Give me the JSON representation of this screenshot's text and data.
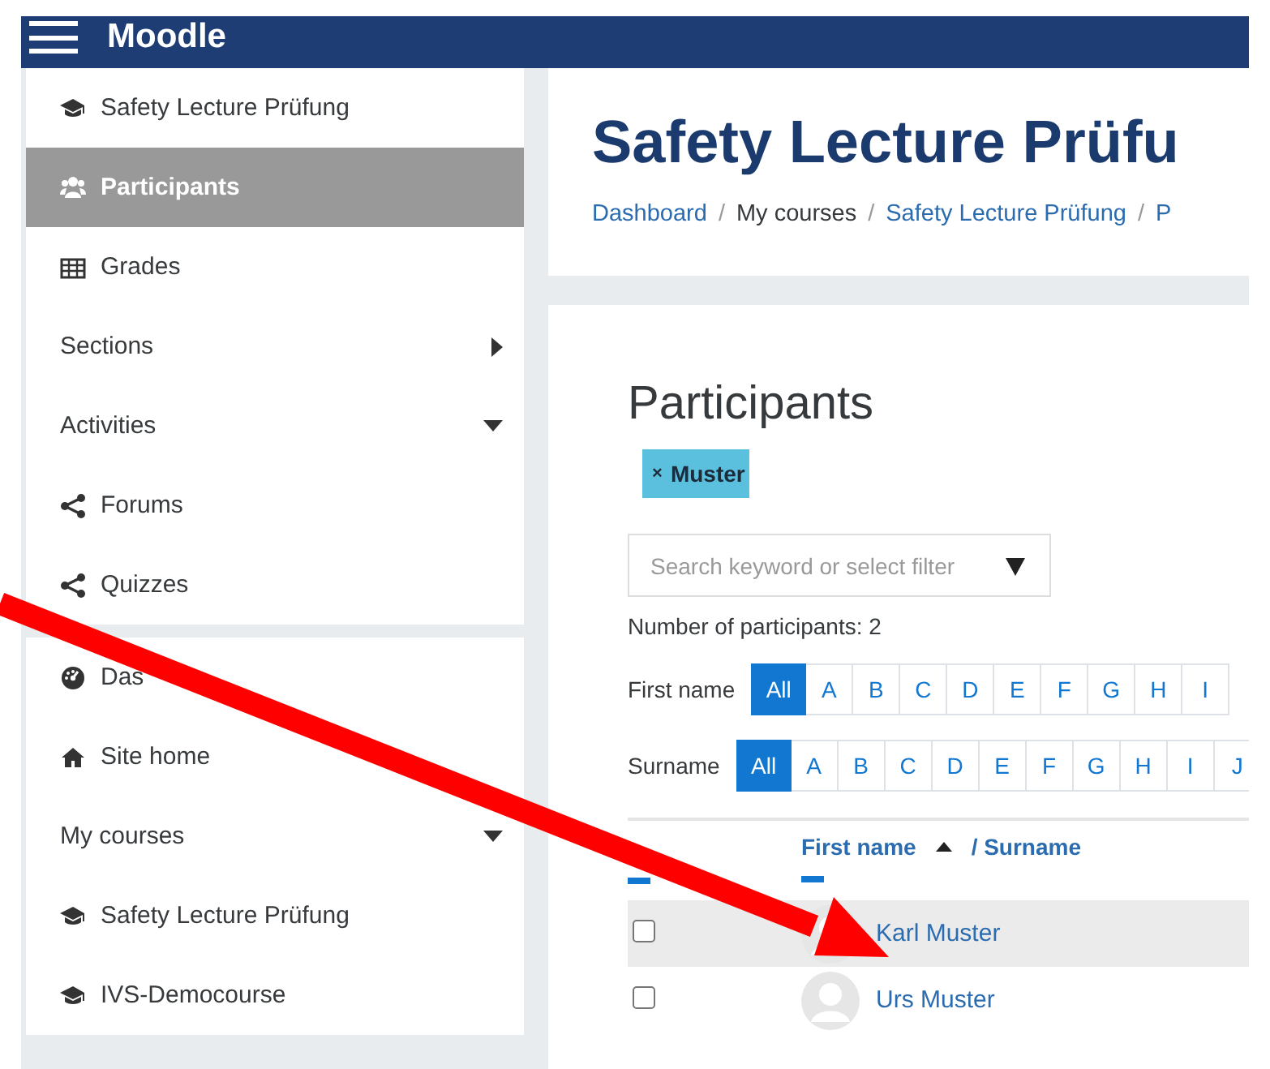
{
  "app": {
    "title": "Moodle"
  },
  "sidebar": {
    "sections": [
      {
        "items": [
          {
            "kind": "course",
            "label": "Safety Lecture Prüfung",
            "selected": false
          },
          {
            "kind": "people",
            "label": "Participants",
            "selected": true
          },
          {
            "kind": "grades",
            "label": "Grades",
            "selected": false
          },
          {
            "kind": "group",
            "label": "Sections",
            "selected": false,
            "expanded": false
          },
          {
            "kind": "group",
            "label": "Activities",
            "selected": false,
            "expanded": true
          },
          {
            "kind": "activity",
            "label": "Forums",
            "selected": false
          },
          {
            "kind": "activity",
            "label": "Quizzes",
            "selected": false
          }
        ]
      },
      {
        "items": [
          {
            "kind": "dashboard",
            "label": "Das",
            "selected": false
          },
          {
            "kind": "home",
            "label": "Site home",
            "selected": false
          },
          {
            "kind": "group",
            "label": "My courses",
            "selected": false,
            "expanded": true
          },
          {
            "kind": "course",
            "label": "Safety Lecture Prüfung",
            "selected": false
          },
          {
            "kind": "course",
            "label": "IVS-Democourse",
            "selected": false
          }
        ]
      }
    ]
  },
  "header": {
    "title": "Safety Lecture Prüfu",
    "breadcrumb": [
      {
        "label": "Dashboard",
        "link": true,
        "separator": "/"
      },
      {
        "label": "My courses",
        "link": false,
        "separator": "/"
      },
      {
        "label": "Safety Lecture Prüfung",
        "link": true,
        "separator": "/"
      },
      {
        "label": "P",
        "link": true
      }
    ]
  },
  "participants": {
    "heading": "Participants",
    "filter_chip": {
      "remove": "×",
      "label": "Muster"
    },
    "search": {
      "placeholder": "Search keyword or select filter"
    },
    "count": "Number of participants: 2",
    "initials_bars": [
      {
        "label": "First name",
        "letters": [
          {
            "label": "All",
            "selected": true
          },
          {
            "label": "A",
            "selected": false
          },
          {
            "label": "B",
            "selected": false
          },
          {
            "label": "C",
            "selected": false
          },
          {
            "label": "D",
            "selected": false
          },
          {
            "label": "E",
            "selected": false
          },
          {
            "label": "F",
            "selected": false
          },
          {
            "label": "G",
            "selected": false
          },
          {
            "label": "H",
            "selected": false
          },
          {
            "label": "I",
            "selected": false
          }
        ]
      },
      {
        "label": "Surname",
        "letters": [
          {
            "label": "All",
            "selected": true
          },
          {
            "label": "A",
            "selected": false
          },
          {
            "label": "B",
            "selected": false
          },
          {
            "label": "C",
            "selected": false
          },
          {
            "label": "D",
            "selected": false
          },
          {
            "label": "E",
            "selected": false
          },
          {
            "label": "F",
            "selected": false
          },
          {
            "label": "G",
            "selected": false
          },
          {
            "label": "H",
            "selected": false
          },
          {
            "label": "I",
            "selected": false
          },
          {
            "label": "J",
            "selected": false
          }
        ]
      }
    ],
    "table": {
      "columns": [
        {
          "label": "First name",
          "sorted": true
        },
        {
          "label": "/ Surname",
          "sorted": false
        }
      ],
      "rows": [
        {
          "name": "Karl Muster",
          "checked": false,
          "hovered": true
        },
        {
          "name": "Urs Muster",
          "checked": false,
          "hovered": false
        }
      ]
    }
  }
}
